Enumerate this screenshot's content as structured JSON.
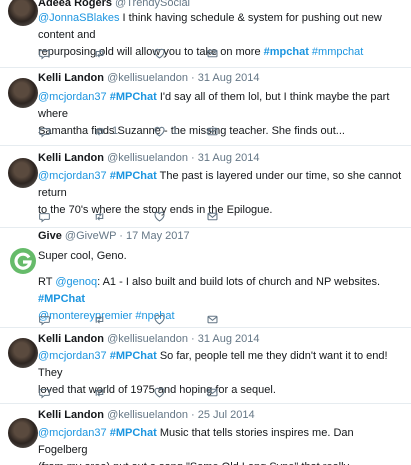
{
  "tweets": [
    {
      "name": "Adeea Rogers",
      "handle": "@TrendySocial",
      "line1": [
        {
          "t": "@JonnaSBlakes",
          "c": "link"
        },
        {
          "t": " I think having schedule & system for pushing out new content and",
          "c": ""
        }
      ],
      "line2": [
        {
          "t": "repurposing old will allow you to take on more ",
          "c": ""
        },
        {
          "t": "#mpchat",
          "c": "tag"
        },
        {
          "t": " #mmpchat",
          "c": "link"
        }
      ],
      "retweets": "",
      "likes": ""
    },
    {
      "name": "Kelli Landon",
      "handle": "@kellisuelandon",
      "date": "31 Aug 2014",
      "line1": [
        {
          "t": "@mcjordan37",
          "c": "link"
        },
        {
          "t": " #MPChat",
          "c": "tag"
        },
        {
          "t": " I'd say all of them lol, but I think maybe the part where",
          "c": ""
        }
      ],
      "line2": [
        {
          "t": "Samantha finds Suzanne - the missing teacher. She finds out...",
          "c": ""
        }
      ],
      "retweets": "1",
      "likes": "1"
    },
    {
      "name": "Kelli Landon",
      "handle": "@kellisuelandon",
      "date": "31 Aug 2014",
      "line1": [
        {
          "t": "@mcjordan37",
          "c": "link"
        },
        {
          "t": " #MPChat",
          "c": "tag"
        },
        {
          "t": " The past is layered under our time, so she cannot return",
          "c": ""
        }
      ],
      "line2": [
        {
          "t": "to the 70's where the story ends in the Epilogue.",
          "c": ""
        }
      ],
      "retweets": "",
      "likes": ""
    },
    {
      "name": "Give",
      "handle": "@GiveWP",
      "date": "17 May 2017",
      "line1": [
        {
          "t": "Super cool, Geno.",
          "c": ""
        }
      ],
      "line2": [
        {
          "t": "RT ",
          "c": ""
        },
        {
          "t": "@genoq",
          "c": "link"
        },
        {
          "t": ": A1 - I also built and build lots of church and NP websites. ",
          "c": ""
        },
        {
          "t": "#MPChat",
          "c": "tag"
        }
      ],
      "line3": [
        {
          "t": "@montereypremier",
          "c": "link"
        },
        {
          "t": " #npchat",
          "c": "link"
        }
      ],
      "retweets": "",
      "likes": ""
    },
    {
      "name": "Kelli Landon",
      "handle": "@kellisuelandon",
      "date": "31 Aug 2014",
      "line1": [
        {
          "t": "@mcjordan37",
          "c": "link"
        },
        {
          "t": " #MPChat",
          "c": "tag"
        },
        {
          "t": " So far, people tell me they didn't want it to end! They",
          "c": ""
        }
      ],
      "line2": [
        {
          "t": "loved that world of 1975 and hoping for a sequel.",
          "c": ""
        }
      ],
      "retweets": "",
      "likes": ""
    },
    {
      "name": "Kelli Landon",
      "handle": "@kellisuelandon",
      "date": "25 Jul 2014",
      "line1": [
        {
          "t": "@mcjordan37",
          "c": "link"
        },
        {
          "t": " #MPChat",
          "c": "tag"
        },
        {
          "t": "  Music that tells stories inspires me. Dan Fogelberg",
          "c": ""
        }
      ],
      "line2": [
        {
          "t": "(from my area) put out a song \"Same Old Lang Syne\" that really....",
          "c": ""
        }
      ],
      "retweets": "",
      "likes": ""
    }
  ],
  "meta_sep": " · ",
  "icons": {
    "reply": "reply-icon",
    "retweet": "retweet-icon",
    "like": "heart-icon",
    "message": "direct-message-icon"
  },
  "colors": {
    "link": "#1b95e0",
    "muted": "#657786",
    "text": "#14171a",
    "give_brand": "#66bb6a"
  }
}
